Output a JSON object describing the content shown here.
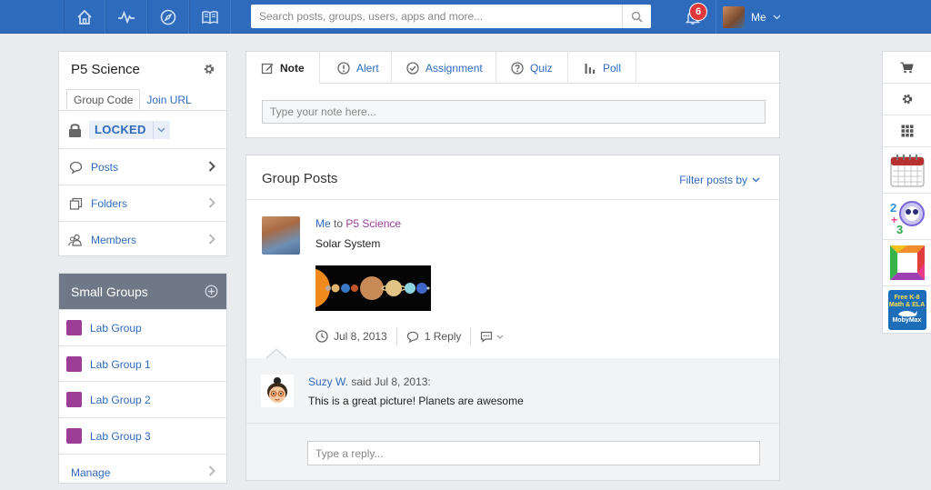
{
  "topbar": {
    "nav_icons": [
      "home-icon",
      "pulse-icon",
      "compass-icon",
      "book-icon"
    ],
    "search_placeholder": "Search posts, groups, users, apps and more...",
    "notification_count": "6",
    "user_label": "Me",
    "brand_color": "#2f6bbd"
  },
  "group": {
    "name": "P5 Science",
    "tabs": [
      "Group Code",
      "Join URL"
    ],
    "lock_status": "LOCKED",
    "nav": [
      {
        "label": "Posts",
        "icon": "speech-bubble-icon"
      },
      {
        "label": "Folders",
        "icon": "folders-icon"
      },
      {
        "label": "Members",
        "icon": "members-icon"
      }
    ]
  },
  "small_groups": {
    "title": "Small Groups",
    "items": [
      "Lab Group",
      "Lab Group 1",
      "Lab Group 2",
      "Lab Group 3"
    ],
    "manage_label": "Manage",
    "group_color": "#9c3d96"
  },
  "composer": {
    "tabs": [
      {
        "label": "Note",
        "icon": "note-edit-icon"
      },
      {
        "label": "Alert",
        "icon": "alert-icon"
      },
      {
        "label": "Assignment",
        "icon": "check-circle-icon"
      },
      {
        "label": "Quiz",
        "icon": "question-icon"
      },
      {
        "label": "Poll",
        "icon": "bar-chart-icon"
      }
    ],
    "placeholder": "Type your note here..."
  },
  "posts": {
    "title": "Group Posts",
    "filter_label": "Filter posts by",
    "post": {
      "author": "Me",
      "to": "to",
      "group": "P5 Science",
      "text": "Solar System",
      "date": "Jul 8, 2013",
      "replies": "1 Reply"
    },
    "comment": {
      "author": "Suzy W.",
      "said": "said Jul 8, 2013:",
      "text": "This is a great picture! Planets are awesome"
    },
    "reply_placeholder": "Type a reply..."
  },
  "right_sidebar": {
    "icons": [
      "cart-icon",
      "gear-icon",
      "apps-grid-icon"
    ],
    "apps": [
      "calendar-app-icon",
      "math-app-icon",
      "frame-app-icon",
      "mobymax-app-icon"
    ],
    "mobymax_text": [
      "Free K-8",
      "Math & ELA",
      "MobyMax"
    ]
  }
}
